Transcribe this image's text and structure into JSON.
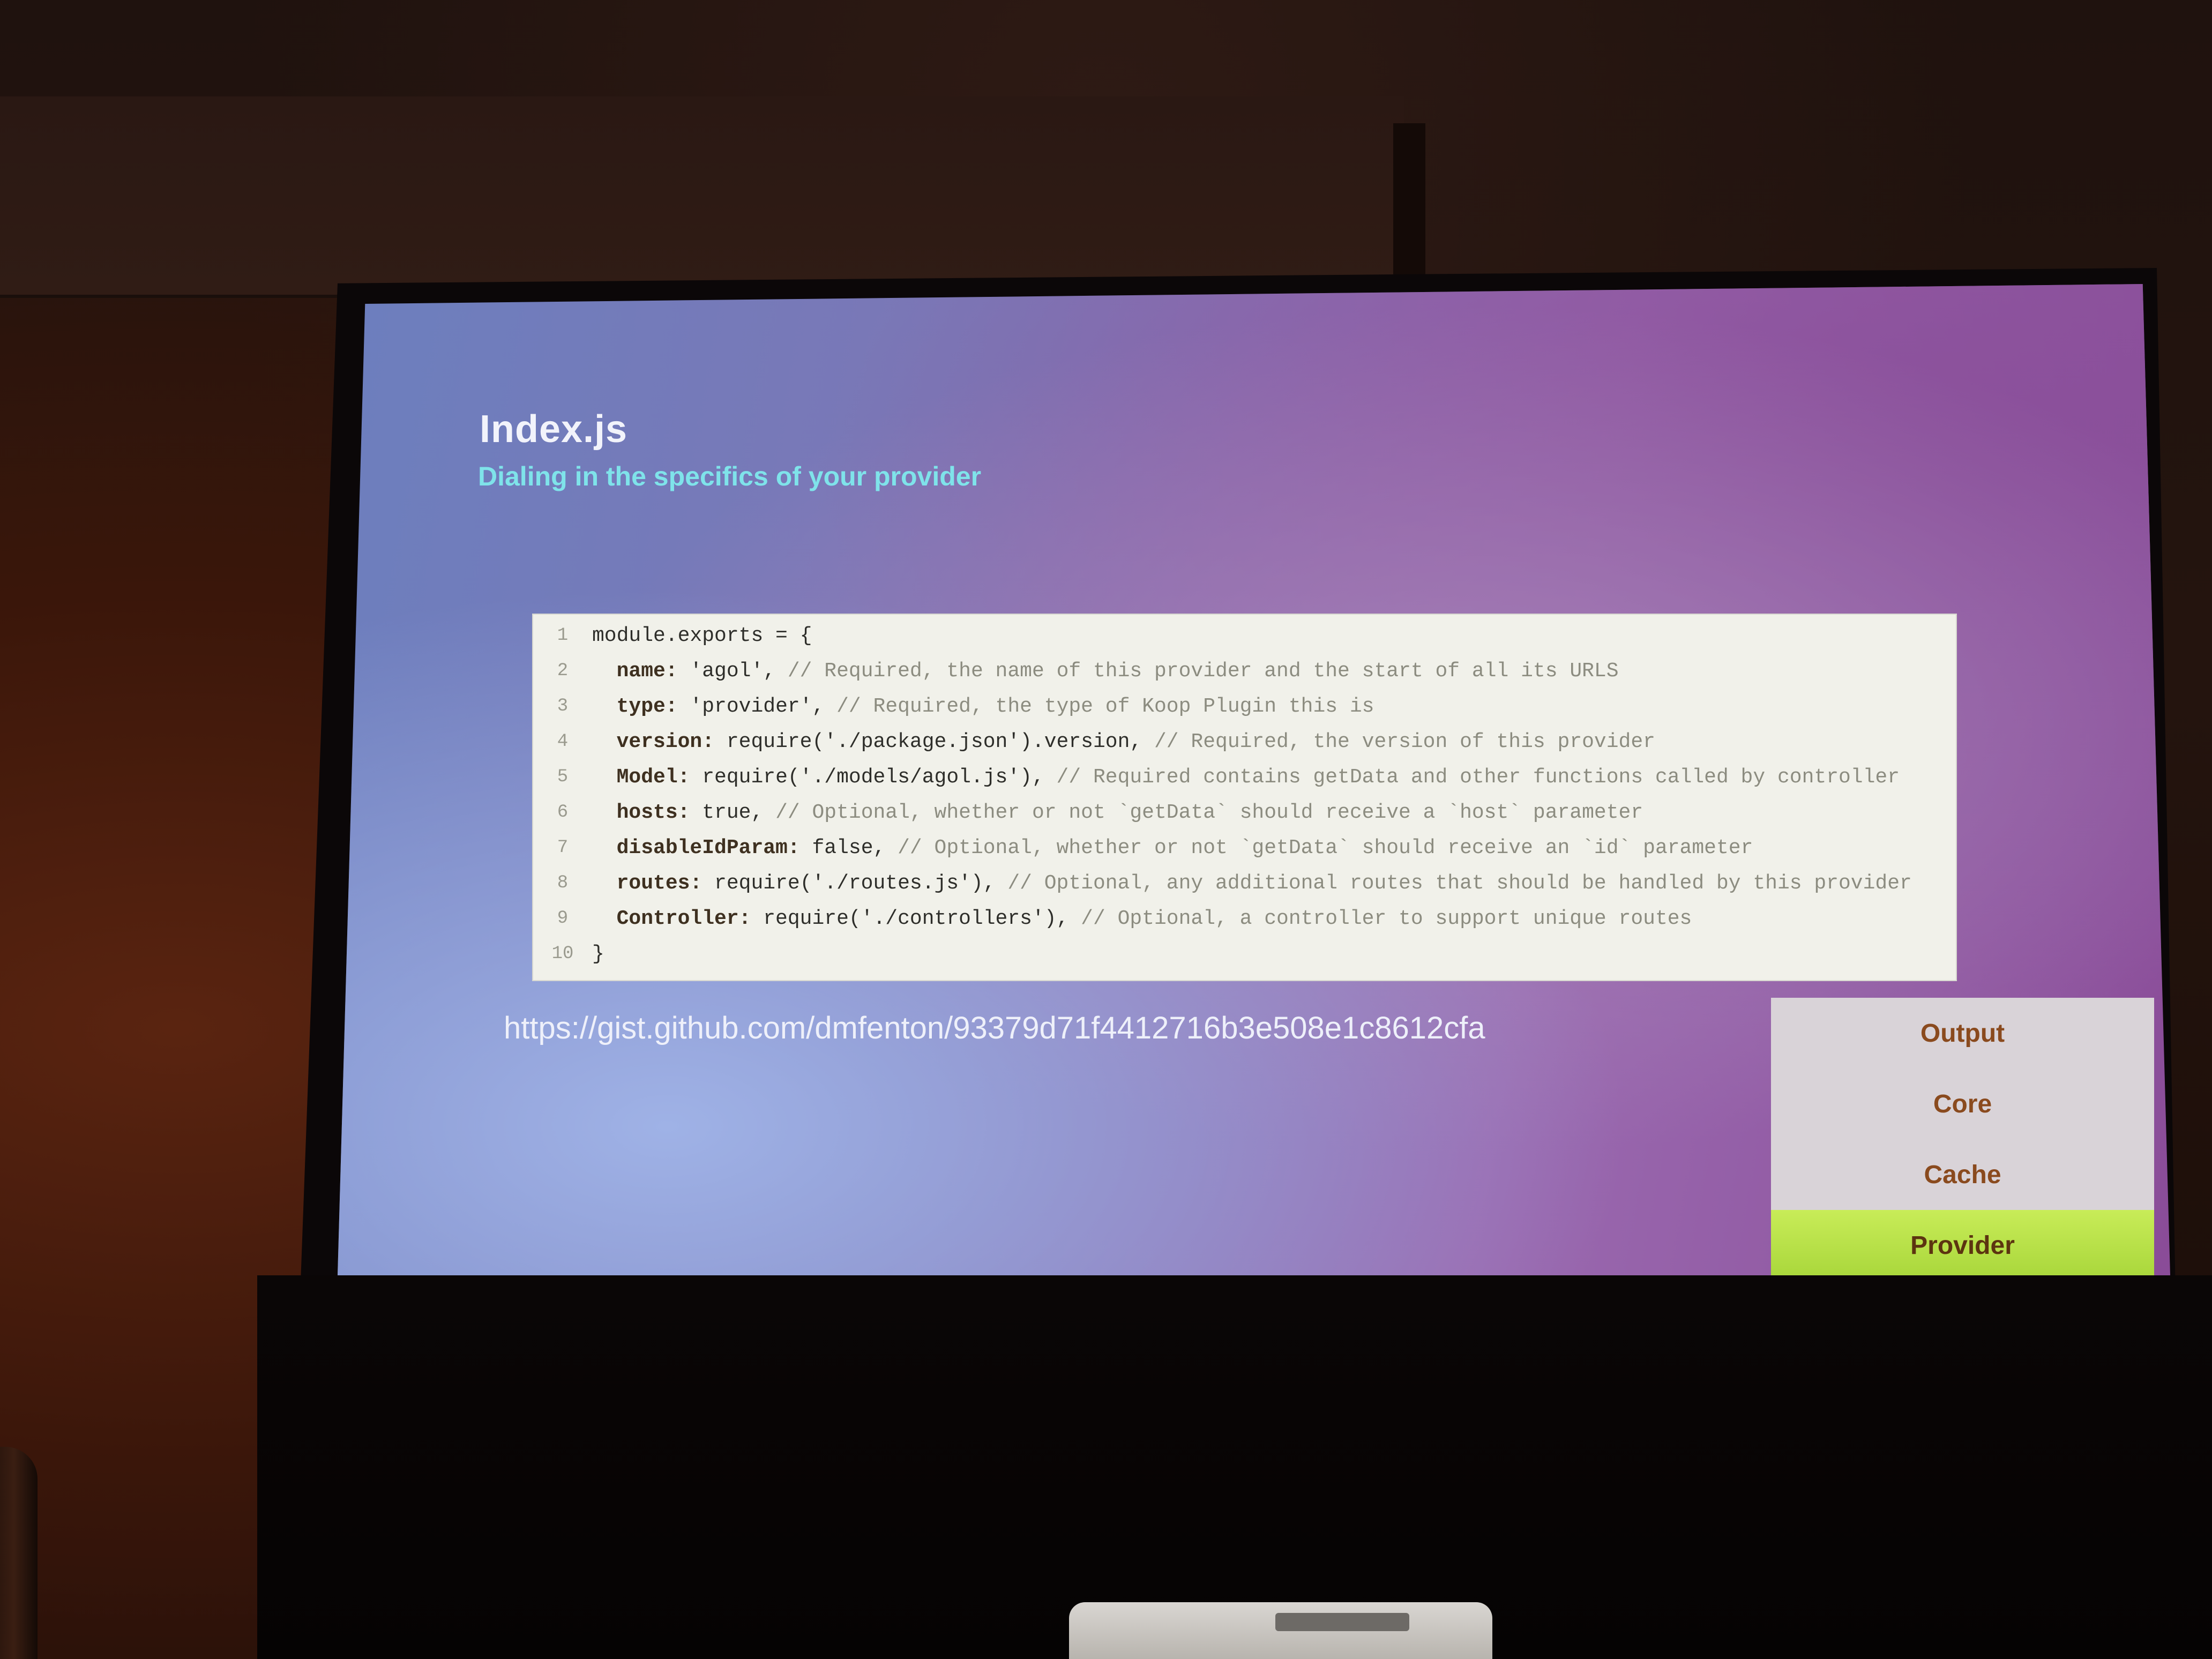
{
  "slide": {
    "title": "Index.js",
    "subtitle": "Dialing in the specifics of your provider",
    "code_lines": [
      {
        "num": "1",
        "key": "",
        "text": "module.exports = {",
        "comment": ""
      },
      {
        "num": "2",
        "key": "  name:",
        "text": " 'agol',",
        "comment": " // Required, the name of this provider and the start of all its URLS"
      },
      {
        "num": "3",
        "key": "  type:",
        "text": " 'provider',",
        "comment": " // Required, the type of Koop Plugin this is"
      },
      {
        "num": "4",
        "key": "  version:",
        "text": " require('./package.json').version,",
        "comment": " // Required, the version of this provider"
      },
      {
        "num": "5",
        "key": "  Model:",
        "text": " require('./models/agol.js'),",
        "comment": " // Required contains getData and other functions called by controller"
      },
      {
        "num": "6",
        "key": "  hosts:",
        "text": " true,",
        "comment": " // Optional, whether or not `getData` should receive a `host` parameter"
      },
      {
        "num": "7",
        "key": "  disableIdParam:",
        "text": " false,",
        "comment": " // Optional, whether or not `getData` should receive an `id` parameter"
      },
      {
        "num": "8",
        "key": "  routes:",
        "text": " require('./routes.js'),",
        "comment": " // Optional, any additional routes that should be handled by this provider"
      },
      {
        "num": "9",
        "key": "  Controller:",
        "text": " require('./controllers'),",
        "comment": " // Optional, a controller to support unique routes"
      },
      {
        "num": "10",
        "key": "",
        "text": "}",
        "comment": ""
      }
    ],
    "url": "https://gist.github.com/dmfenton/93379d71f4412716b3e508e1c8612cfa",
    "menu": {
      "items": [
        "Output",
        "Core",
        "Cache",
        "Provider"
      ],
      "active": "Provider"
    }
  },
  "colors": {
    "title": "#f2f3fb",
    "subtitle": "#7fe3ea",
    "menu_text": "#8a4a1e",
    "menu_active_bg": "#b8e04a"
  }
}
